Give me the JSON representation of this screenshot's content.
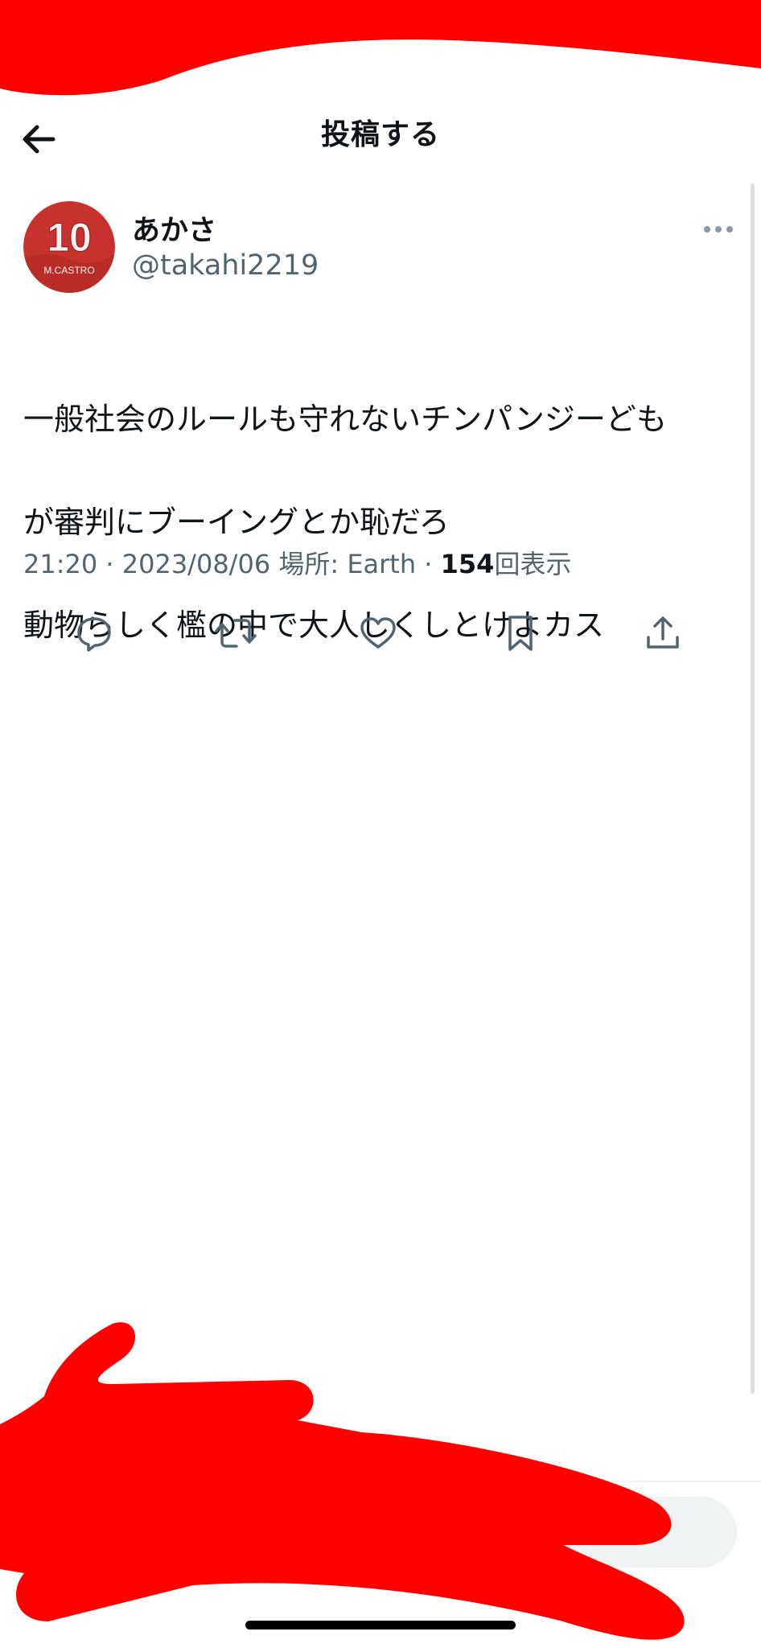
{
  "header": {
    "title": "投稿する"
  },
  "tweet": {
    "avatar_label": "M.CASTRO",
    "avatar_number": "10",
    "display_name": "あかさ",
    "handle": "@takahi2219",
    "text_lines": [
      "一般社会のルールも守れないチンパンジーども",
      "が審判にブーイングとか恥だろ",
      "動物らしく檻の中で大人しくしとけよカス"
    ],
    "time": "21:20",
    "separator": " · ",
    "date": "2023/08/06",
    "location_label": "場所: ",
    "location": "Earth",
    "views_count": "154",
    "views_label": "回表示"
  },
  "actions": [
    {
      "icon": "reply-icon"
    },
    {
      "icon": "retweet-icon"
    },
    {
      "icon": "like-icon"
    },
    {
      "icon": "bookmark-icon"
    },
    {
      "icon": "share-icon"
    }
  ],
  "colors": {
    "text": "#0f1419",
    "secondary": "#536471",
    "redaction": "#ff0000",
    "avatar_bg": "#c8322e"
  }
}
